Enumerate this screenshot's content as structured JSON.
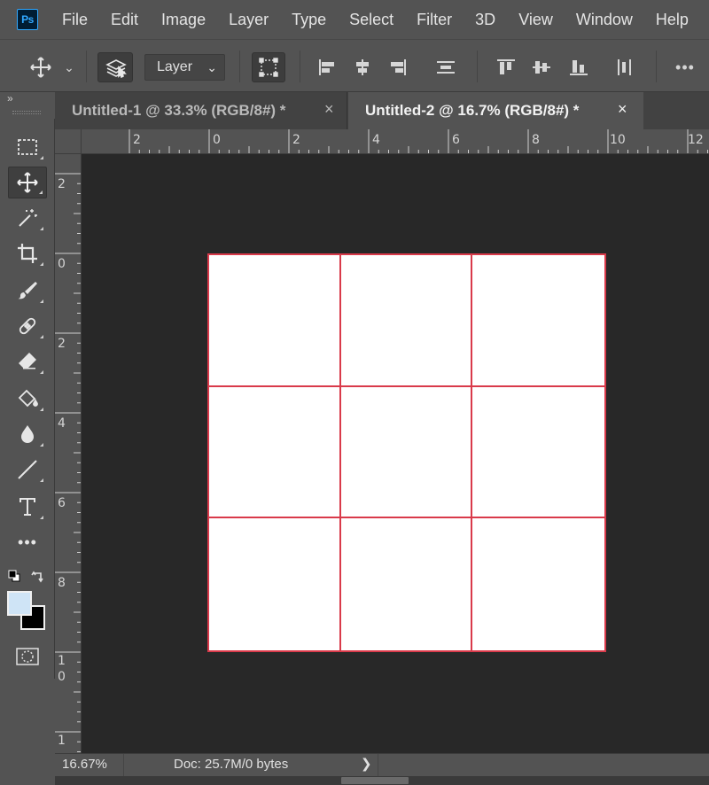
{
  "app": {
    "logo_text": "Ps"
  },
  "menu": [
    "File",
    "Edit",
    "Image",
    "Layer",
    "Type",
    "Select",
    "Filter",
    "3D",
    "View",
    "Window",
    "Help"
  ],
  "options": {
    "auto_select_target": "Layer",
    "more_glyph": "•••"
  },
  "toolbar": {
    "expand_glyph": "»"
  },
  "tabs": [
    {
      "title": "Untitled-1 @ 33.3% (RGB/8#) *",
      "close": "×",
      "active": false
    },
    {
      "title": "Untitled-2 @ 16.7% (RGB/8#) *",
      "close": "×",
      "active": true
    }
  ],
  "rulers": {
    "horizontal": [
      "2",
      "0",
      "2",
      "4",
      "6",
      "8",
      "10",
      "12"
    ],
    "vertical": [
      "2",
      "0",
      "2",
      "4",
      "6",
      "8",
      "1",
      "0",
      "1"
    ]
  },
  "colors": {
    "foreground": "#cfe4f6",
    "background": "#000000",
    "guide": "#d93a4a",
    "ui_panel": "#535353",
    "pasteboard": "#282828"
  },
  "status": {
    "zoom": "16.67%",
    "doc_info": "Doc: 25.7M/0 bytes",
    "arrow": "❯"
  }
}
